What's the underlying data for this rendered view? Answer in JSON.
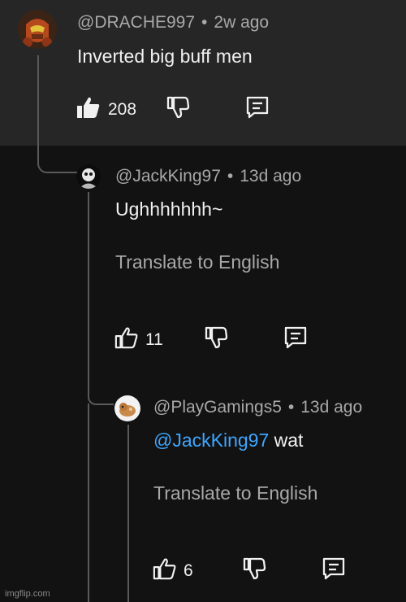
{
  "comments": [
    {
      "author": "@DRACHE997",
      "age": "2w ago",
      "text": "Inverted big buff men",
      "likes": "208"
    },
    {
      "author": "@JackKing97",
      "age": "13d ago",
      "text": "Ughhhhhhh~",
      "translate": "Translate to English",
      "likes": "11"
    },
    {
      "author": "@PlayGamings5",
      "age": "13d ago",
      "mention": "@JackKing97",
      "text": " wat",
      "translate": "Translate to English",
      "likes": "6"
    }
  ],
  "separator": "•",
  "icons": [
    "like-icon",
    "dislike-icon",
    "reply-icon"
  ],
  "colors": {
    "mention": "#3ea6ff",
    "top_background": "#262626",
    "background": "#121212"
  },
  "watermark": "imgflip.com"
}
